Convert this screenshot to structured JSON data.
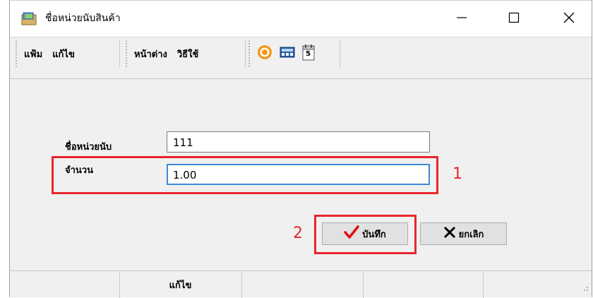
{
  "window": {
    "title": "ชื่อหน่วยนับสินค้า",
    "icon": "app-folder-icon"
  },
  "menu": {
    "group1": [
      "แฟ้ม",
      "แก้ไข"
    ],
    "group2": [
      "หน้าต่าง",
      "วิธีใช้"
    ],
    "tool_icons": [
      "orange-target-icon",
      "calculator-icon",
      "calendar-icon"
    ],
    "calendar_number": "5"
  },
  "form": {
    "unit_name_label": "ชื่อหน่วยนับ",
    "unit_name_value": "111",
    "quantity_label": "จำนวน",
    "quantity_value": "1.00"
  },
  "annotations": {
    "marker1": "1",
    "marker2": "2",
    "color": "#e8262c"
  },
  "buttons": {
    "save_label": "บันทึก",
    "cancel_label": "ยกเลิก"
  },
  "status": {
    "mode": "แก้ไข"
  }
}
